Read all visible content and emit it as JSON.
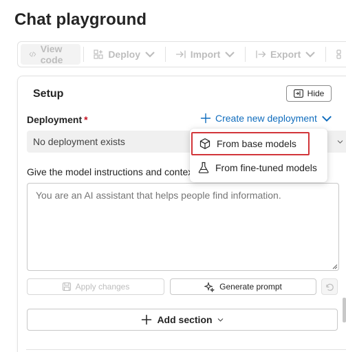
{
  "page": {
    "title": "Chat playground"
  },
  "toolbar": {
    "view_code": "View code",
    "deploy": "Deploy",
    "import": "Import",
    "export": "Export"
  },
  "setup": {
    "title": "Setup",
    "hide_label": "Hide",
    "deployment_label": "Deployment",
    "required_mark": "*",
    "create_link": "Create new deployment",
    "selected_deployment": "No deployment exists",
    "instructions_label": "Give the model instructions and context",
    "instructions_placeholder": "You are an AI assistant that helps people find information.",
    "apply_changes": "Apply changes",
    "generate_prompt": "Generate prompt",
    "add_section": "Add section"
  },
  "menu": {
    "items": [
      {
        "label": "From base models",
        "icon": "cube-icon",
        "highlighted": true
      },
      {
        "label": "From fine-tuned models",
        "icon": "flask-icon",
        "highlighted": false
      }
    ]
  },
  "colors": {
    "accent": "#0f6cbd",
    "required": "#c50f1f",
    "highlight_border": "#d13438",
    "disabled_text": "#bdbdbd"
  }
}
